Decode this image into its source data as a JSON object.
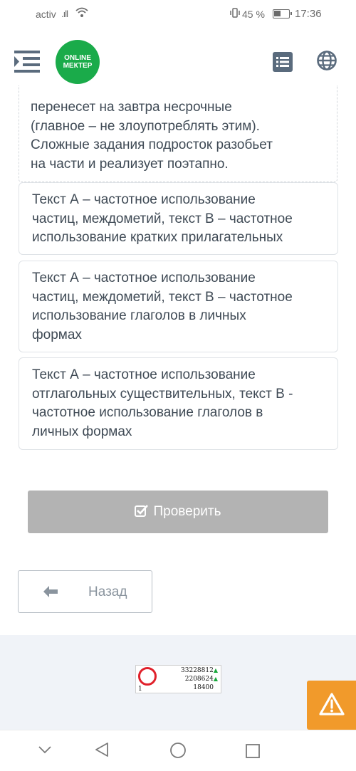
{
  "status_bar": {
    "carrier": "activ",
    "battery": "45 %",
    "time": "17:36",
    "icons": [
      "signal-icon",
      "wifi-icon",
      "vibrate-icon",
      "battery-icon"
    ]
  },
  "header": {
    "logo_line1": "ONLINE",
    "logo_line2": "МЕКТЕР",
    "icons": [
      "menu-icon",
      "list-icon",
      "globe-icon"
    ],
    "brand_color": "#1aab4a"
  },
  "question": {
    "lines": [
      "перенесет на завтра несрочные",
      "(главное – не злоупотреблять этим).",
      "Сложные задания подросток разобьет",
      "на части и реализует поэтапно."
    ]
  },
  "answers": [
    {
      "lines": [
        "Текст А – частотное использование",
        "частиц, междометий, текст В – частотное",
        "использование кратких прилагательных"
      ]
    },
    {
      "lines": [
        "Текст А – частотное использование",
        "частиц, междометий, текст В – частотное",
        "использование глаголов в личных",
        "формах"
      ]
    },
    {
      "lines": [
        "Текст А – частотное использование",
        "отглагольных существительных, текст В -",
        "частотное использование глаголов в",
        "личных формах"
      ]
    }
  ],
  "actions": {
    "check_label": "Проверить",
    "back_label": "Назад"
  },
  "counter": {
    "count_1": "33228812",
    "count_2": "2208624",
    "count_3": "18400",
    "count_small": "1"
  },
  "colors": {
    "check_button_bg": "#b3b3b3",
    "warning_bg": "#f19a2b",
    "footer_bg": "#f0f3f8"
  },
  "nav_bar": {
    "icons": [
      "collapse-icon",
      "back-triangle-icon",
      "home-circle-icon",
      "recents-square-icon"
    ]
  }
}
